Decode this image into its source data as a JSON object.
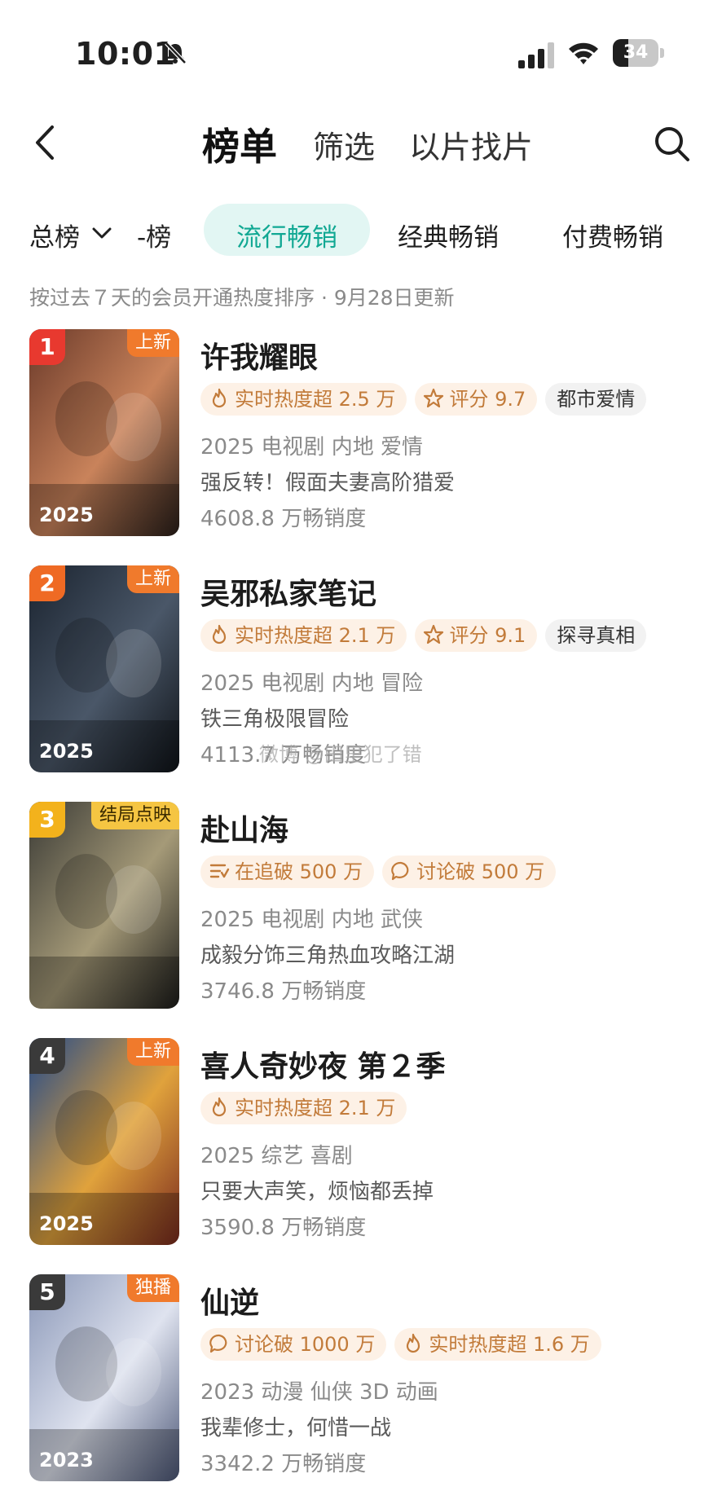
{
  "status_bar": {
    "time": "10:01",
    "battery": "34",
    "battery_level": 0.34
  },
  "nav": {
    "tabs": [
      {
        "label": "榜单",
        "active": true
      },
      {
        "label": "筛选",
        "active": false
      },
      {
        "label": "以片找片",
        "active": false
      }
    ]
  },
  "categories": {
    "main": "总榜",
    "items": [
      {
        "label": "-榜",
        "active": false
      },
      {
        "label": "流行畅销",
        "active": true
      },
      {
        "label": "经典畅销",
        "active": false
      },
      {
        "label": "付费畅销",
        "active": false
      }
    ]
  },
  "subtitle": "按过去７天的会员开通热度排序 · 9月28日更新",
  "watermark": "微博 @田里犯了错",
  "colors": {
    "accent": "#11a893",
    "accent_bg": "#e2f6f3",
    "tag_text": "#c27b3a",
    "tag_bg": "#fdf1e6",
    "rank1": "#e8392f",
    "rank2": "#ef6a24",
    "rank3": "#f3b21c",
    "rank_other": "#3a3a3a"
  },
  "items": [
    {
      "rank": "1",
      "badge": "上新",
      "badge_style": "new",
      "year": "2025",
      "title": "许我耀眼",
      "tags": [
        {
          "icon": "flame-icon",
          "text": "实时热度超 2.5 万"
        },
        {
          "icon": "star-icon",
          "text": "评分 9.7"
        },
        {
          "icon": "",
          "text": "都市爱情"
        }
      ],
      "meta": "2025 电视剧 内地 爱情",
      "desc": "强反转！假面夫妻高阶猎爱",
      "sales": "4608.8 万畅销度"
    },
    {
      "rank": "2",
      "badge": "上新",
      "badge_style": "new",
      "year": "2025",
      "title": "吴邪私家笔记",
      "tags": [
        {
          "icon": "flame-icon",
          "text": "实时热度超 2.1 万"
        },
        {
          "icon": "star-icon",
          "text": "评分 9.1"
        },
        {
          "icon": "",
          "text": "探寻真相"
        }
      ],
      "meta": "2025 电视剧 内地 冒险",
      "desc": "铁三角极限冒险",
      "sales": "4113.7 万畅销度"
    },
    {
      "rank": "3",
      "badge": "结局点映",
      "badge_style": "finale",
      "year": "",
      "title": "赴山海",
      "tags": [
        {
          "icon": "list-icon",
          "text": "在追破 500 万"
        },
        {
          "icon": "comment-icon",
          "text": "讨论破 500 万"
        }
      ],
      "meta": "2025 电视剧 内地 武侠",
      "desc": "成毅分饰三角热血攻略江湖",
      "sales": "3746.8 万畅销度"
    },
    {
      "rank": "4",
      "badge": "上新",
      "badge_style": "new",
      "year": "2025",
      "title": "喜人奇妙夜 第２季",
      "tags": [
        {
          "icon": "flame-icon",
          "text": "实时热度超 2.1 万"
        }
      ],
      "meta": "2025 综艺 喜剧",
      "desc": "只要大声笑，烦恼都丢掉",
      "sales": "3590.8 万畅销度"
    },
    {
      "rank": "5",
      "badge": "独播",
      "badge_style": "new",
      "year": "2023",
      "title": "仙逆",
      "tags": [
        {
          "icon": "comment-icon",
          "text": "讨论破 1000 万"
        },
        {
          "icon": "flame-icon",
          "text": "实时热度超 1.6 万"
        }
      ],
      "meta": "2023 动漫 仙侠 3D 动画",
      "desc": "我辈修士，何惜一战",
      "sales": "3342.2 万畅销度"
    }
  ]
}
